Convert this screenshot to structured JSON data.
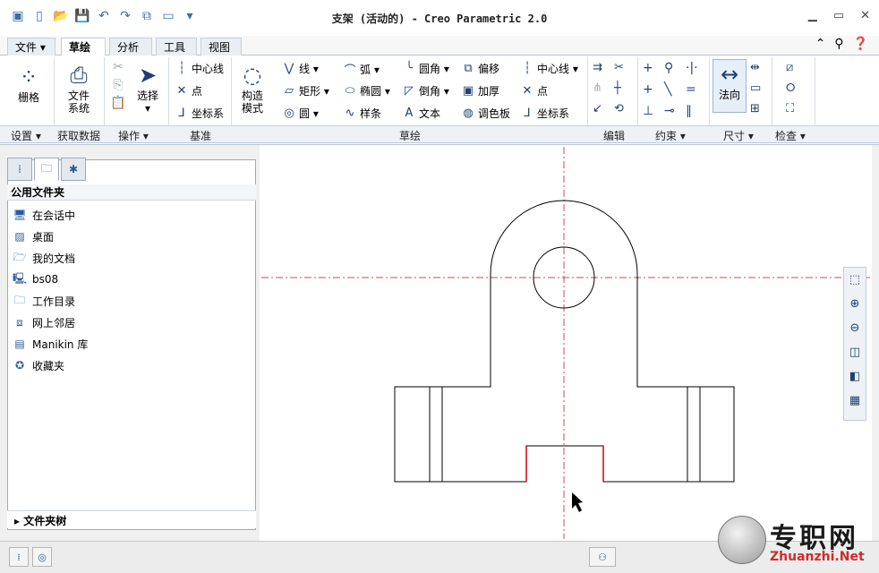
{
  "window": {
    "title": "支架 (活动的) - Creo Parametric 2.0"
  },
  "tabs": [
    {
      "label": "文件 ▾"
    },
    {
      "label": "草绘"
    },
    {
      "label": "分析"
    },
    {
      "label": "工具"
    },
    {
      "label": "视图"
    }
  ],
  "ribbon": {
    "grid": "栅格",
    "file_system": [
      "文件",
      "系统"
    ],
    "select": "选择",
    "datum": {
      "centerline": "中心线",
      "point": "点",
      "csys": "坐标系"
    },
    "construct_mode": [
      "构造",
      "模式"
    ],
    "sketch": {
      "line": "线 ▾",
      "arc": "弧 ▾",
      "fillet": "圆角 ▾",
      "offset": "偏移",
      "rect": "矩形 ▾",
      "ellipse": "椭圆 ▾",
      "chamfer": "倒角 ▾",
      "thicken": "加厚",
      "circle": "圆 ▾",
      "spline": "样条",
      "text": "文本",
      "palette": "调色板",
      "centerline": "中心线 ▾",
      "point": "点",
      "csys": "坐标系"
    },
    "normal": "法向"
  },
  "group_labels": {
    "setup": "设置 ▾",
    "get_data": "获取数据",
    "operations": "操作 ▾",
    "datum": "基准",
    "sketch": "草绘",
    "edit": "编辑",
    "constrain": "约束 ▾",
    "dimension": "尺寸 ▾",
    "inspect": "检查 ▾"
  },
  "panel": {
    "header": "公用文件夹",
    "items": [
      "在会话中",
      "桌面",
      "我的文档",
      "bs08",
      "工作目录",
      "网上邻居",
      "Manikin 库",
      "收藏夹"
    ],
    "footer": "▸ 文件夹树"
  },
  "watermark": {
    "cn": "专职网",
    "en": "Zhuanzhi.Net"
  },
  "colors": {
    "centerline": "#d04a5a",
    "geometry": "#000000",
    "highlight": "#d4000f"
  }
}
